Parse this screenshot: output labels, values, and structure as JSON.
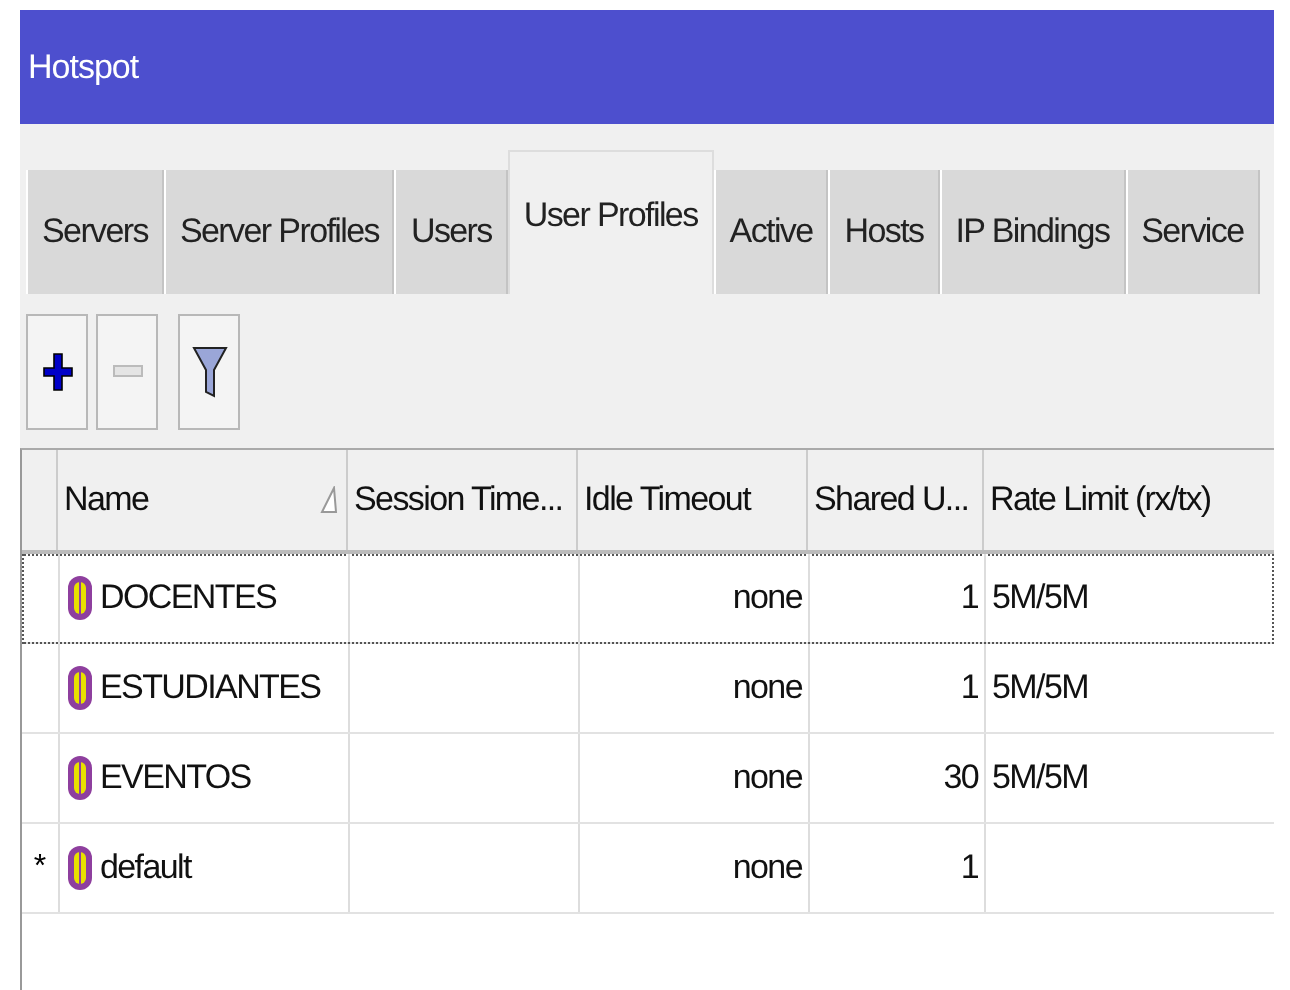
{
  "window": {
    "title": "Hotspot"
  },
  "tabs": [
    {
      "label": "Servers",
      "selected": false
    },
    {
      "label": "Server Profiles",
      "selected": false
    },
    {
      "label": "Users",
      "selected": false
    },
    {
      "label": "User Profiles",
      "selected": true
    },
    {
      "label": "Active",
      "selected": false
    },
    {
      "label": "Hosts",
      "selected": false
    },
    {
      "label": "IP Bindings",
      "selected": false
    },
    {
      "label": "Service",
      "selected": false
    }
  ],
  "toolbar": [
    {
      "kind": "add",
      "disabled": false
    },
    {
      "kind": "remove",
      "disabled": true
    },
    {
      "kind": "filter",
      "disabled": false
    }
  ],
  "table": {
    "columns": [
      "Name",
      "Session Time...",
      "Idle Timeout",
      "Shared U...",
      "Rate Limit (rx/tx)"
    ],
    "rows": [
      {
        "marker": "",
        "name": "DOCENTES",
        "session_timeout": "",
        "idle_timeout": "none",
        "shared_users": "1",
        "rate_limit": "5M/5M",
        "focused": true
      },
      {
        "marker": "",
        "name": "ESTUDIANTES",
        "session_timeout": "",
        "idle_timeout": "none",
        "shared_users": "1",
        "rate_limit": "5M/5M",
        "focused": false
      },
      {
        "marker": "",
        "name": "EVENTOS",
        "session_timeout": "",
        "idle_timeout": "none",
        "shared_users": "30",
        "rate_limit": "5M/5M",
        "focused": false
      },
      {
        "marker": "*",
        "name": "default",
        "session_timeout": "",
        "idle_timeout": "none",
        "shared_users": "1",
        "rate_limit": "",
        "focused": false
      }
    ]
  }
}
